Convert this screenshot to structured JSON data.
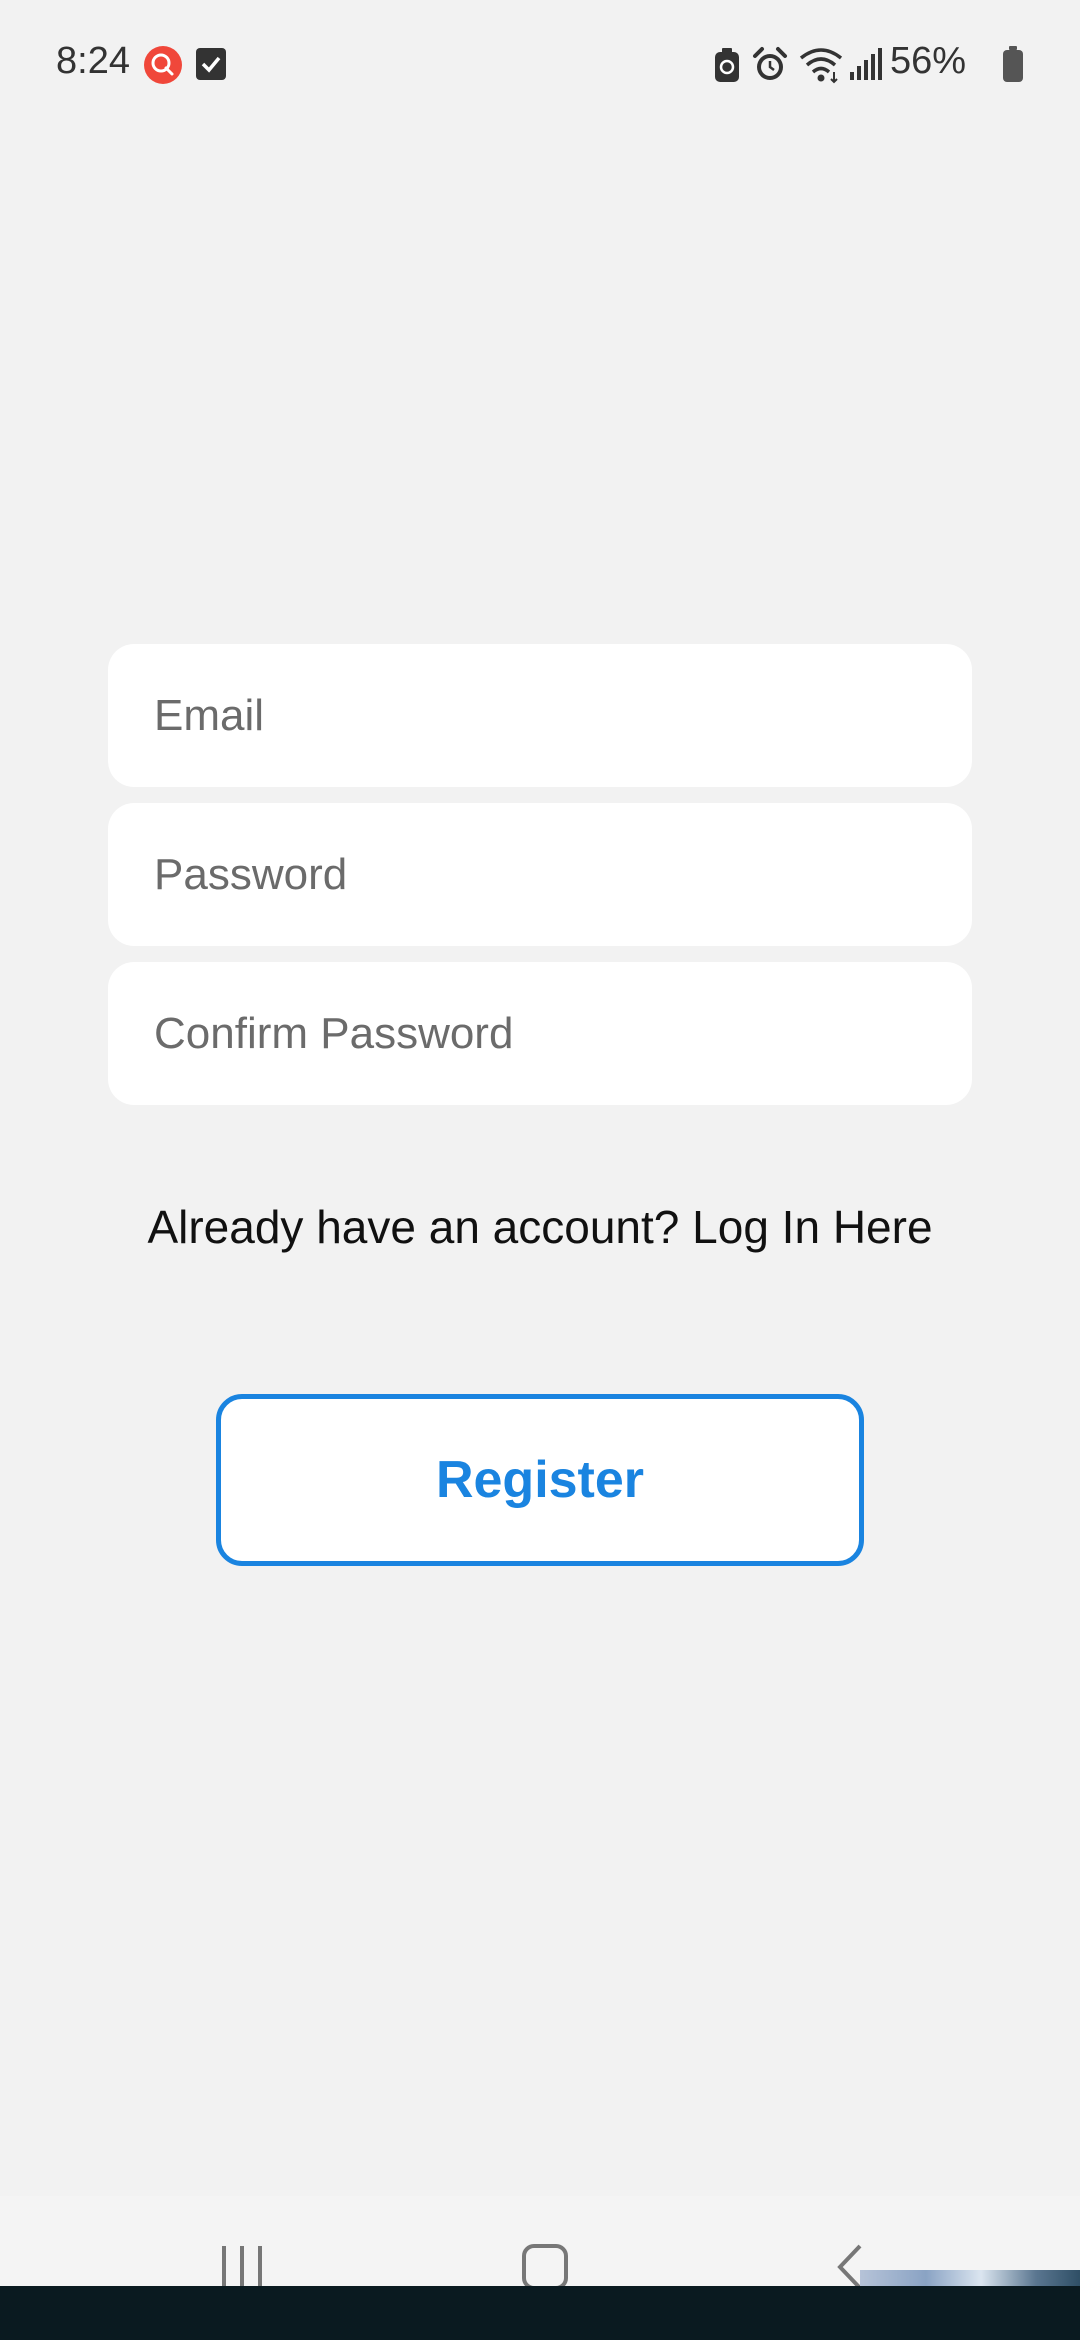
{
  "status_bar": {
    "time": "8:24",
    "battery_percent": "56%",
    "icons": [
      "search-notification-icon",
      "checkbox-notification-icon",
      "battery-saver-icon",
      "alarm-icon",
      "wifi-icon",
      "signal-icon",
      "battery-icon"
    ]
  },
  "form": {
    "email_placeholder": "Email",
    "password_placeholder": "Password",
    "confirm_password_placeholder": "Confirm Password",
    "login_prompt": "Already have an account? Log In Here",
    "register_label": "Register"
  },
  "colors": {
    "accent": "#1a84e0",
    "background": "#f2f2f2",
    "field_background": "#ffffff"
  },
  "nav_bar": {
    "icons": [
      "recent-apps-icon",
      "home-icon",
      "back-icon"
    ]
  }
}
